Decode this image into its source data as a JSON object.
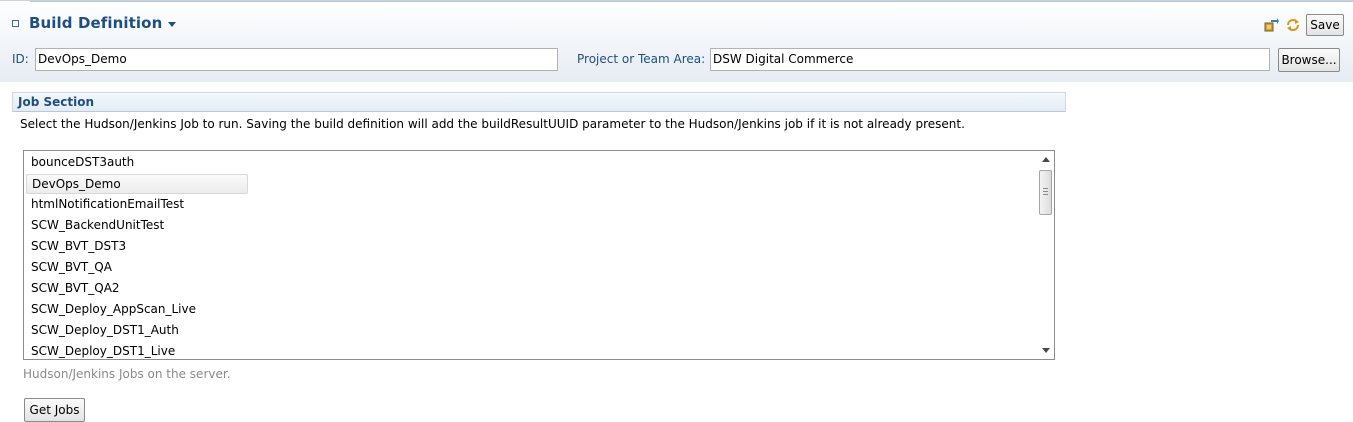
{
  "header": {
    "title": "Build Definition",
    "save_label": "Save",
    "icons": [
      "run-build-icon",
      "refresh-icon"
    ]
  },
  "fields": {
    "id_label": "ID:",
    "id_value": "DevOps_Demo",
    "project_label": "Project or Team Area:",
    "project_value": "DSW Digital Commerce",
    "browse_label": "Browse..."
  },
  "job_section": {
    "title": "Job Section",
    "description": "Select the Hudson/Jenkins Job to run. Saving the build definition will add the buildResultUUID parameter to the Hudson/Jenkins job if it is not already present.",
    "jobs": [
      "bounceDST3auth",
      "DevOps_Demo",
      "htmlNotificationEmailTest",
      "SCW_BackendUnitTest",
      "SCW_BVT_DST3",
      "SCW_BVT_QA",
      "SCW_BVT_QA2",
      "SCW_Deploy_AppScan_Live",
      "SCW_Deploy_DST1_Auth",
      "SCW_Deploy_DST1_Live"
    ],
    "selected_job": "DevOps_Demo",
    "hint": "Hudson/Jenkins Jobs on the server.",
    "get_jobs_label": "Get Jobs"
  },
  "colors": {
    "title": "#1e4f7f",
    "header_bg": "#e6ecf3",
    "hint": "#8a8a8a"
  }
}
